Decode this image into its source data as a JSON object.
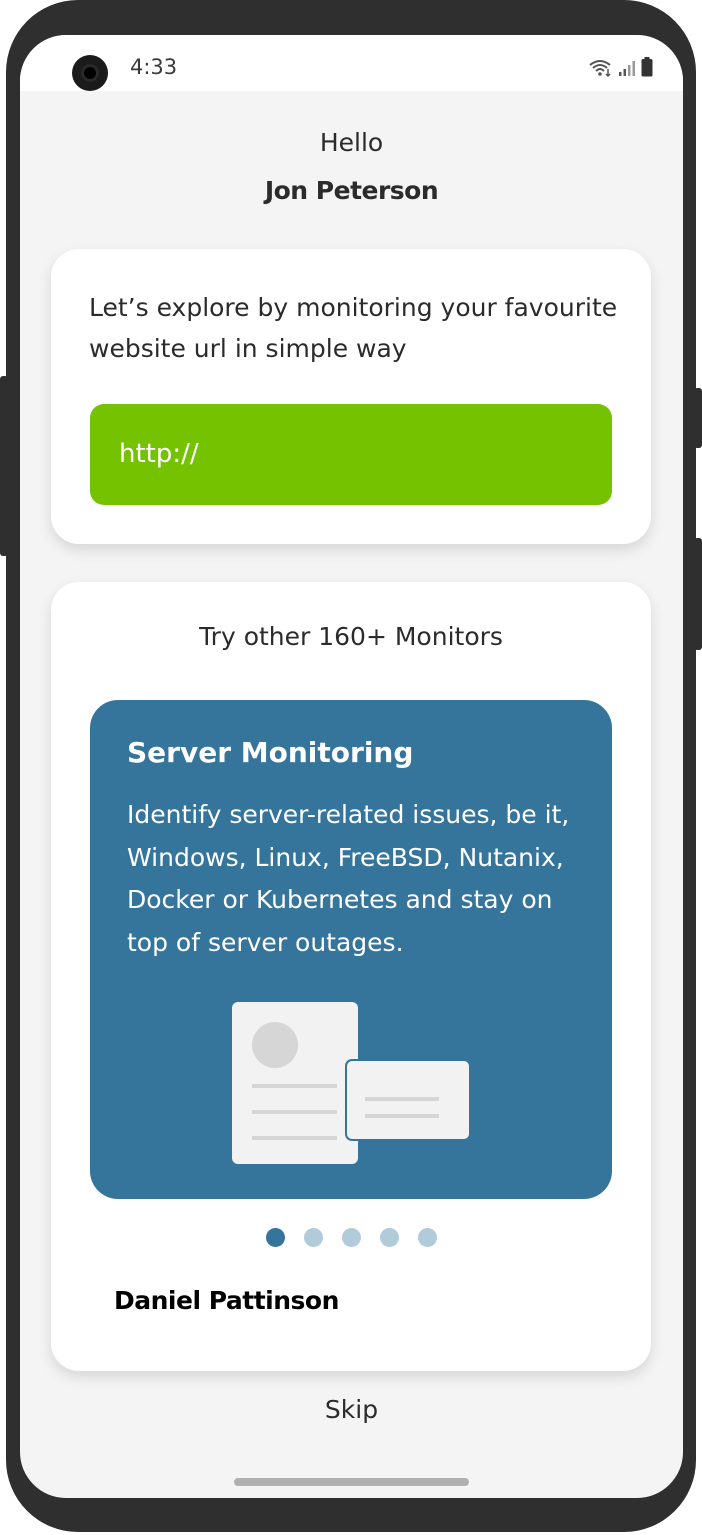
{
  "status_bar": {
    "time": "4:33",
    "icons": [
      "wifi-icon",
      "signal-icon",
      "battery-icon"
    ]
  },
  "greeting": {
    "hello": "Hello",
    "user_name": "Jon Peterson"
  },
  "url_card": {
    "prompt": "Let’s explore by monitoring your favourite website url in simple way",
    "url_placeholder": "http://"
  },
  "monitors_card": {
    "title": "Try other 160+ Monitors",
    "slide": {
      "title": "Server Monitoring",
      "description": "Identify server-related issues, be it, Windows, Linux, FreeBSD, Nutanix, Docker or Kubernetes and stay on top of server outages."
    },
    "pagination": {
      "total": 5,
      "active_index": 0
    },
    "footer_name": "Daniel Pattinson"
  },
  "skip_label": "Skip",
  "colors": {
    "accent_green": "#74c200",
    "monitor_blue": "#35759c",
    "dot_inactive": "#b2cbdb",
    "background": "#f4f4f4"
  }
}
